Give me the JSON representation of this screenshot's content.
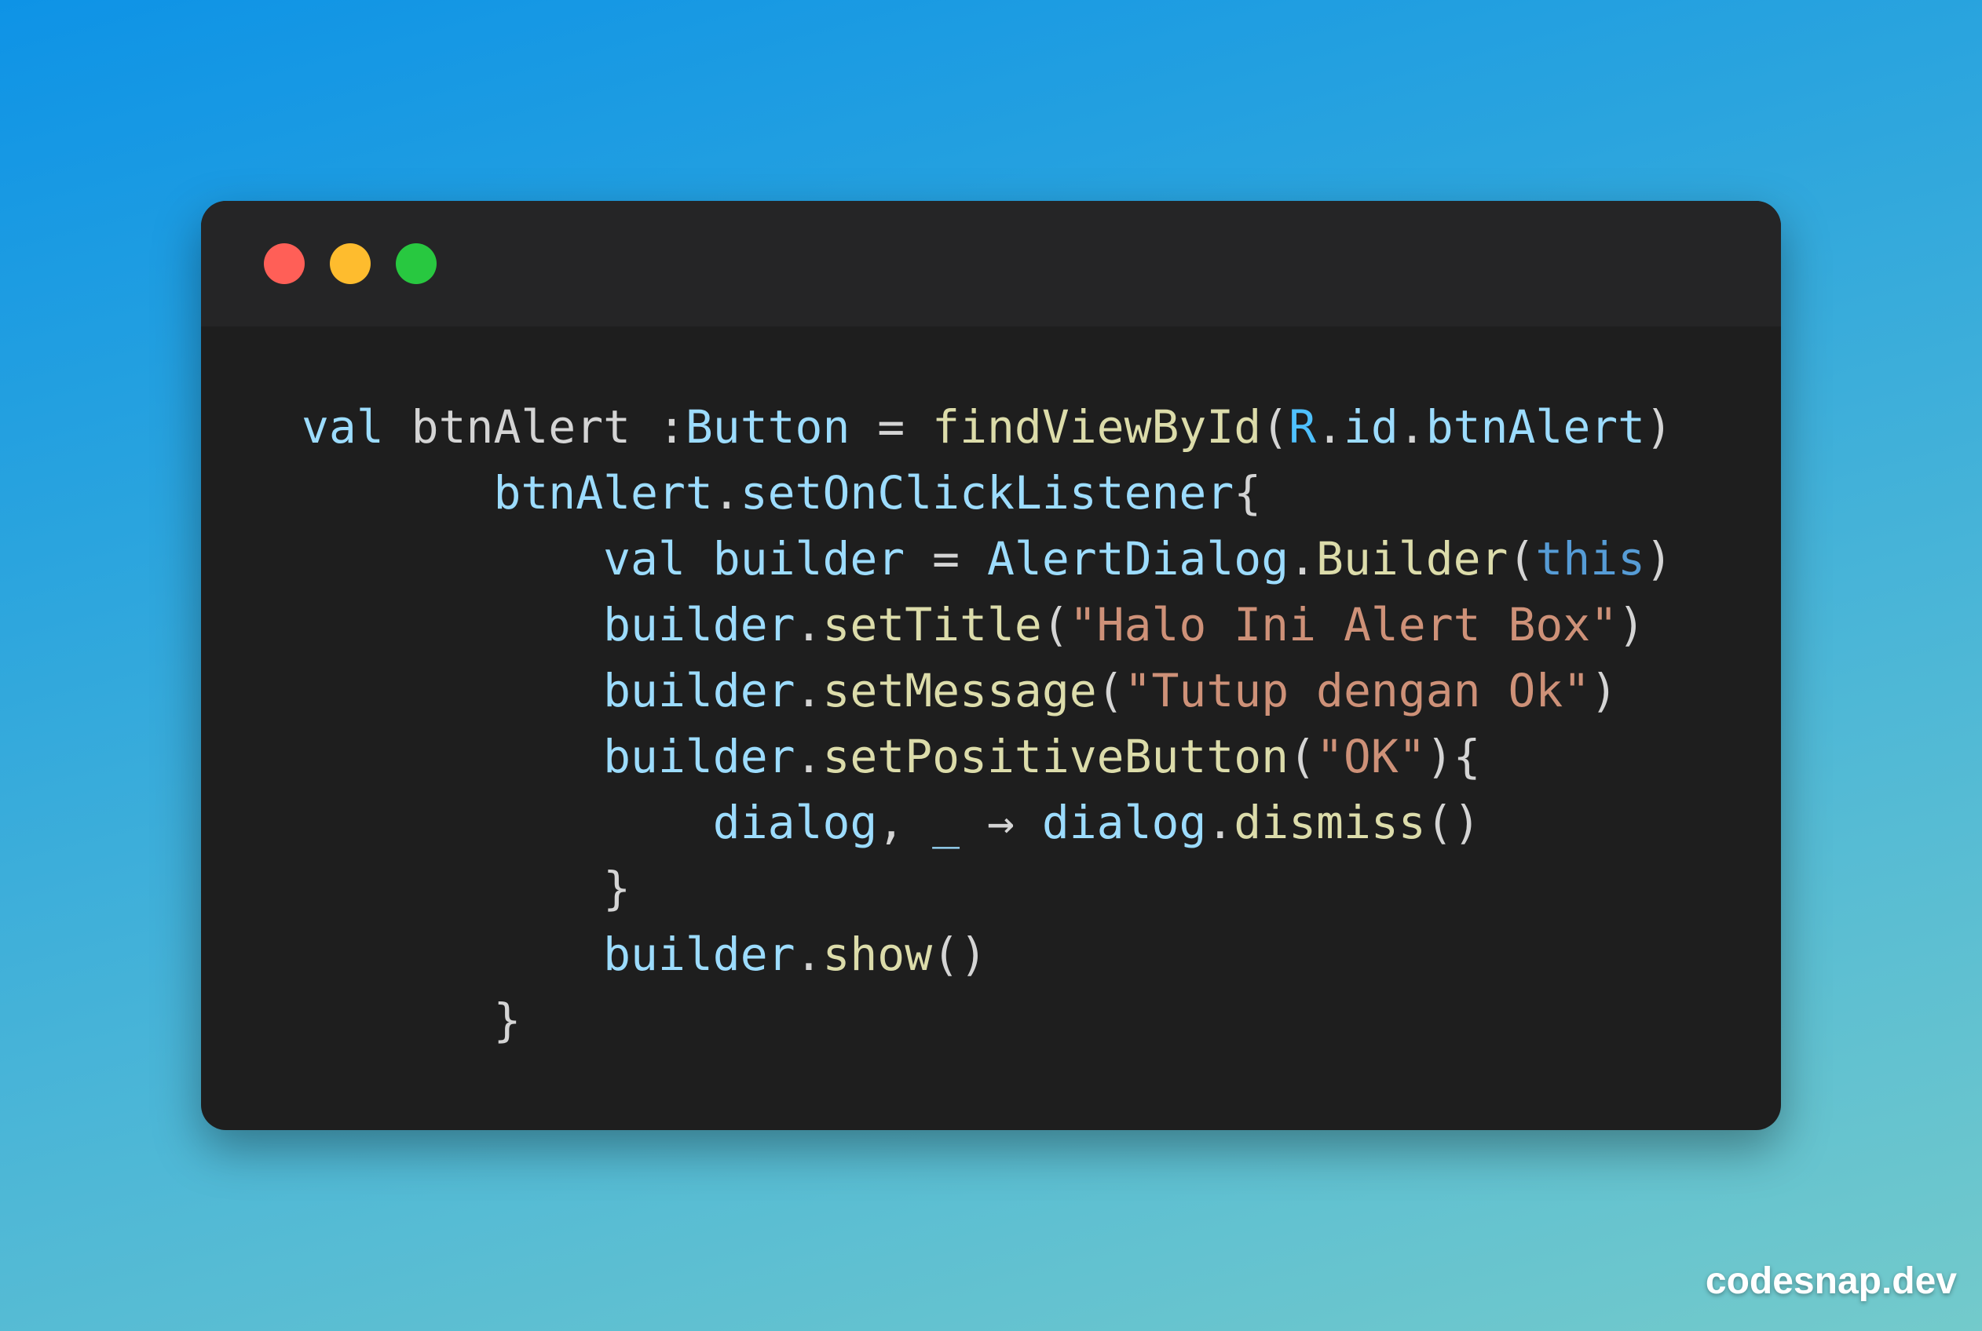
{
  "colors": {
    "background_gradient": [
      "#0E93E6",
      "#73CACB"
    ],
    "window_background": "#1E1E1E",
    "titlebar_background": "#252526",
    "traffic_lights": {
      "close": "#FF5F57",
      "minimize": "#FEBC2E",
      "maximize": "#28C840"
    },
    "syntax": {
      "keyword": "#9CDCFE",
      "variable": "#9CDCFE",
      "function": "#DCDCAA",
      "constant": "#4FC1FF",
      "string": "#CE9178",
      "this": "#569CD6",
      "plain": "#D4D4D4"
    }
  },
  "window": {
    "traffic_lights": [
      {
        "name": "close",
        "icon": "red-dot-icon"
      },
      {
        "name": "minimize",
        "icon": "yellow-dot-icon"
      },
      {
        "name": "maximize",
        "icon": "green-dot-icon"
      }
    ]
  },
  "code": {
    "language": "kotlin",
    "lines": [
      [
        {
          "text": "val",
          "kind": "keyword"
        },
        {
          "text": " btnAlert :",
          "kind": "plain"
        },
        {
          "text": "Button",
          "kind": "type"
        },
        {
          "text": " = ",
          "kind": "plain"
        },
        {
          "text": "findViewById",
          "kind": "function"
        },
        {
          "text": "(",
          "kind": "punct"
        },
        {
          "text": "R",
          "kind": "constant"
        },
        {
          "text": ".",
          "kind": "punct"
        },
        {
          "text": "id",
          "kind": "variable"
        },
        {
          "text": ".",
          "kind": "punct"
        },
        {
          "text": "btnAlert",
          "kind": "variable"
        },
        {
          "text": ")",
          "kind": "punct"
        }
      ],
      [
        {
          "text": "       ",
          "kind": "plain"
        },
        {
          "text": "btnAlert",
          "kind": "variable"
        },
        {
          "text": ".",
          "kind": "punct"
        },
        {
          "text": "setOnClickListener",
          "kind": "variable"
        },
        {
          "text": "{",
          "kind": "punct"
        }
      ],
      [
        {
          "text": "           ",
          "kind": "plain"
        },
        {
          "text": "val",
          "kind": "keyword"
        },
        {
          "text": " ",
          "kind": "plain"
        },
        {
          "text": "builder",
          "kind": "variable"
        },
        {
          "text": " = ",
          "kind": "plain"
        },
        {
          "text": "AlertDialog",
          "kind": "variable"
        },
        {
          "text": ".",
          "kind": "punct"
        },
        {
          "text": "Builder",
          "kind": "function"
        },
        {
          "text": "(",
          "kind": "punct"
        },
        {
          "text": "this",
          "kind": "this"
        },
        {
          "text": ")",
          "kind": "punct"
        }
      ],
      [
        {
          "text": "           ",
          "kind": "plain"
        },
        {
          "text": "builder",
          "kind": "variable"
        },
        {
          "text": ".",
          "kind": "punct"
        },
        {
          "text": "setTitle",
          "kind": "function"
        },
        {
          "text": "(",
          "kind": "punct"
        },
        {
          "text": "\"Halo Ini Alert Box\"",
          "kind": "string"
        },
        {
          "text": ")",
          "kind": "punct"
        }
      ],
      [
        {
          "text": "           ",
          "kind": "plain"
        },
        {
          "text": "builder",
          "kind": "variable"
        },
        {
          "text": ".",
          "kind": "punct"
        },
        {
          "text": "setMessage",
          "kind": "function"
        },
        {
          "text": "(",
          "kind": "punct"
        },
        {
          "text": "\"Tutup dengan Ok\"",
          "kind": "string"
        },
        {
          "text": ")",
          "kind": "punct"
        }
      ],
      [
        {
          "text": "           ",
          "kind": "plain"
        },
        {
          "text": "builder",
          "kind": "variable"
        },
        {
          "text": ".",
          "kind": "punct"
        },
        {
          "text": "setPositiveButton",
          "kind": "function"
        },
        {
          "text": "(",
          "kind": "punct"
        },
        {
          "text": "\"OK\"",
          "kind": "string"
        },
        {
          "text": "){",
          "kind": "punct"
        }
      ],
      [
        {
          "text": "               ",
          "kind": "plain"
        },
        {
          "text": "dialog",
          "kind": "variable"
        },
        {
          "text": ", ",
          "kind": "punct"
        },
        {
          "text": "_",
          "kind": "variable"
        },
        {
          "text": " → ",
          "kind": "plain"
        },
        {
          "text": "dialog",
          "kind": "variable"
        },
        {
          "text": ".",
          "kind": "punct"
        },
        {
          "text": "dismiss",
          "kind": "function"
        },
        {
          "text": "()",
          "kind": "punct"
        }
      ],
      [
        {
          "text": "           ",
          "kind": "plain"
        },
        {
          "text": "}",
          "kind": "punct"
        }
      ],
      [
        {
          "text": "           ",
          "kind": "plain"
        },
        {
          "text": "builder",
          "kind": "variable"
        },
        {
          "text": ".",
          "kind": "punct"
        },
        {
          "text": "show",
          "kind": "function"
        },
        {
          "text": "()",
          "kind": "punct"
        }
      ],
      [
        {
          "text": "       ",
          "kind": "plain"
        },
        {
          "text": "}",
          "kind": "punct"
        }
      ]
    ]
  },
  "watermark": {
    "text": "codesnap.dev"
  }
}
